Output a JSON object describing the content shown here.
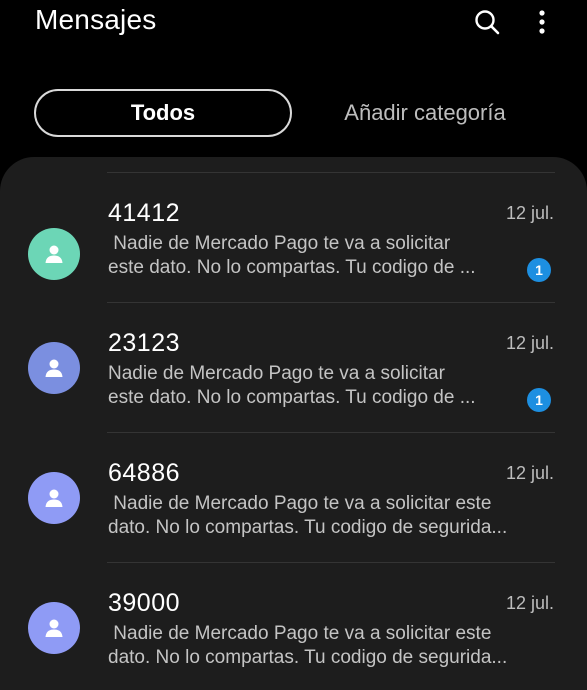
{
  "header": {
    "title": "Mensajes",
    "search_icon": "search-icon",
    "more_icon": "more-vertical-icon"
  },
  "tabs": {
    "all_label": "Todos",
    "add_category_label": "Añadir categoría"
  },
  "colors": {
    "background": "#000000",
    "panel": "#1d1d1d",
    "badge": "#1d8fe1",
    "avatar_1": "#6cd6b6",
    "avatar_2": "#7b8fe0",
    "avatar_3": "#8f9bf5",
    "avatar_4": "#8f9bf5"
  },
  "conversations": [
    {
      "sender": "41412",
      "date": "12 jul.",
      "preview": " Nadie de Mercado Pago te va a solicitar\neste dato. No lo compartas. Tu codigo de ...",
      "unread": "1",
      "avatar_icon": "person-icon"
    },
    {
      "sender": "23123",
      "date": "12 jul.",
      "preview": "Nadie de Mercado Pago te va a solicitar\neste dato. No lo compartas. Tu codigo de ...",
      "unread": "1",
      "avatar_icon": "person-icon"
    },
    {
      "sender": "64886",
      "date": "12 jul.",
      "preview": " Nadie de Mercado Pago te va a solicitar este\ndato. No lo compartas. Tu codigo de segurida...",
      "avatar_icon": "person-icon"
    },
    {
      "sender": "39000",
      "date": "12 jul.",
      "preview": " Nadie de Mercado Pago te va a solicitar este\ndato. No lo compartas. Tu codigo de segurida...",
      "avatar_icon": "person-icon"
    }
  ]
}
